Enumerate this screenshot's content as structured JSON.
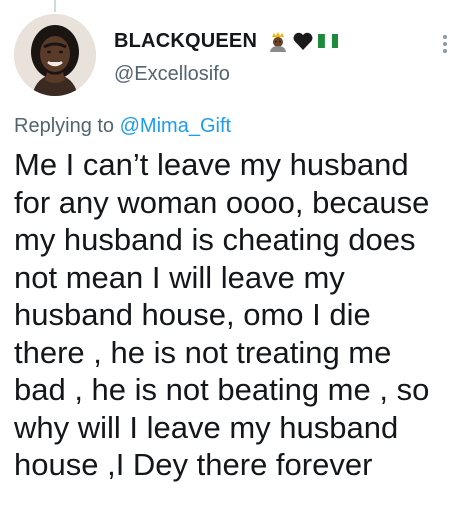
{
  "header": {
    "display_name": "BLACKQUEEN",
    "username": "@Excellosifo",
    "emoji_icons": [
      "crown-person-icon",
      "black-heart-icon",
      "nigeria-flag-icon"
    ]
  },
  "reply": {
    "prefix": "Replying to",
    "handle": "@Mima_Gift"
  },
  "tweet": {
    "lines": [
      "Me I can’t leave my husband",
      "for any woman oooo, because",
      "my husband is cheating does",
      "not mean I will leave my",
      "husband house, omo I die",
      "there , he is not treating me",
      "bad , he is not beating me , so",
      "why will I leave my husband",
      "house ,I Dey there forever"
    ]
  },
  "colors": {
    "link": "#1d9bf0",
    "secondary_text": "#536471",
    "primary_text": "#14171a"
  }
}
